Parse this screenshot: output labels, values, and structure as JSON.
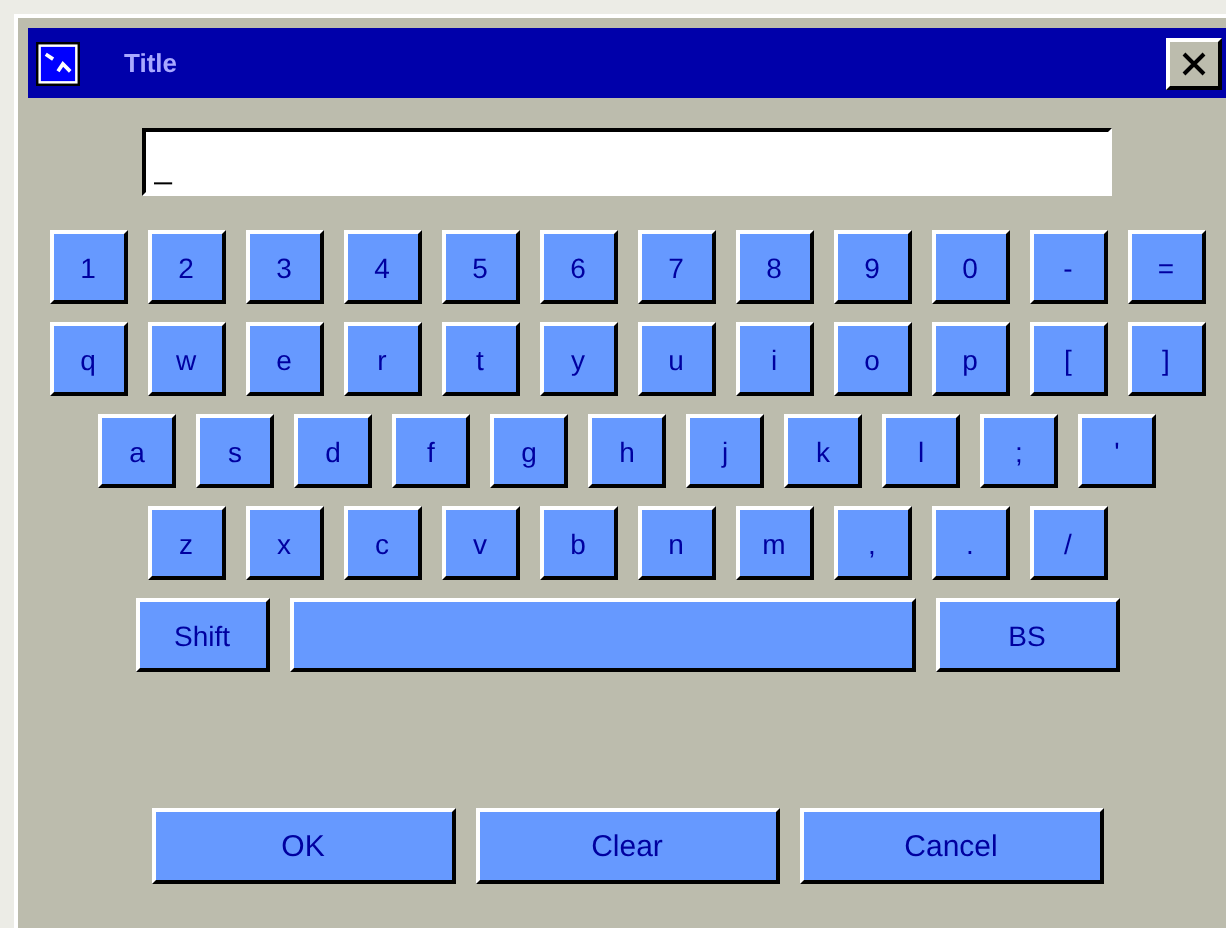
{
  "window": {
    "title": "Title"
  },
  "input": {
    "value": "_"
  },
  "key_rows": [
    [
      "1",
      "2",
      "3",
      "4",
      "5",
      "6",
      "7",
      "8",
      "9",
      "0",
      "-",
      "="
    ],
    [
      "q",
      "w",
      "e",
      "r",
      "t",
      "y",
      "u",
      "i",
      "o",
      "p",
      "[",
      "]"
    ],
    [
      "a",
      "s",
      "d",
      "f",
      "g",
      "h",
      "j",
      "k",
      "l",
      ";",
      "'"
    ],
    [
      "z",
      "x",
      "c",
      "v",
      "b",
      "n",
      "m",
      ",",
      ".",
      "/"
    ]
  ],
  "special_row": [
    {
      "kind": "key",
      "label": "Shift"
    },
    {
      "kind": "space"
    },
    {
      "kind": "key",
      "label": "BS"
    }
  ],
  "buttons": [
    "OK",
    "Clear",
    "Cancel"
  ]
}
